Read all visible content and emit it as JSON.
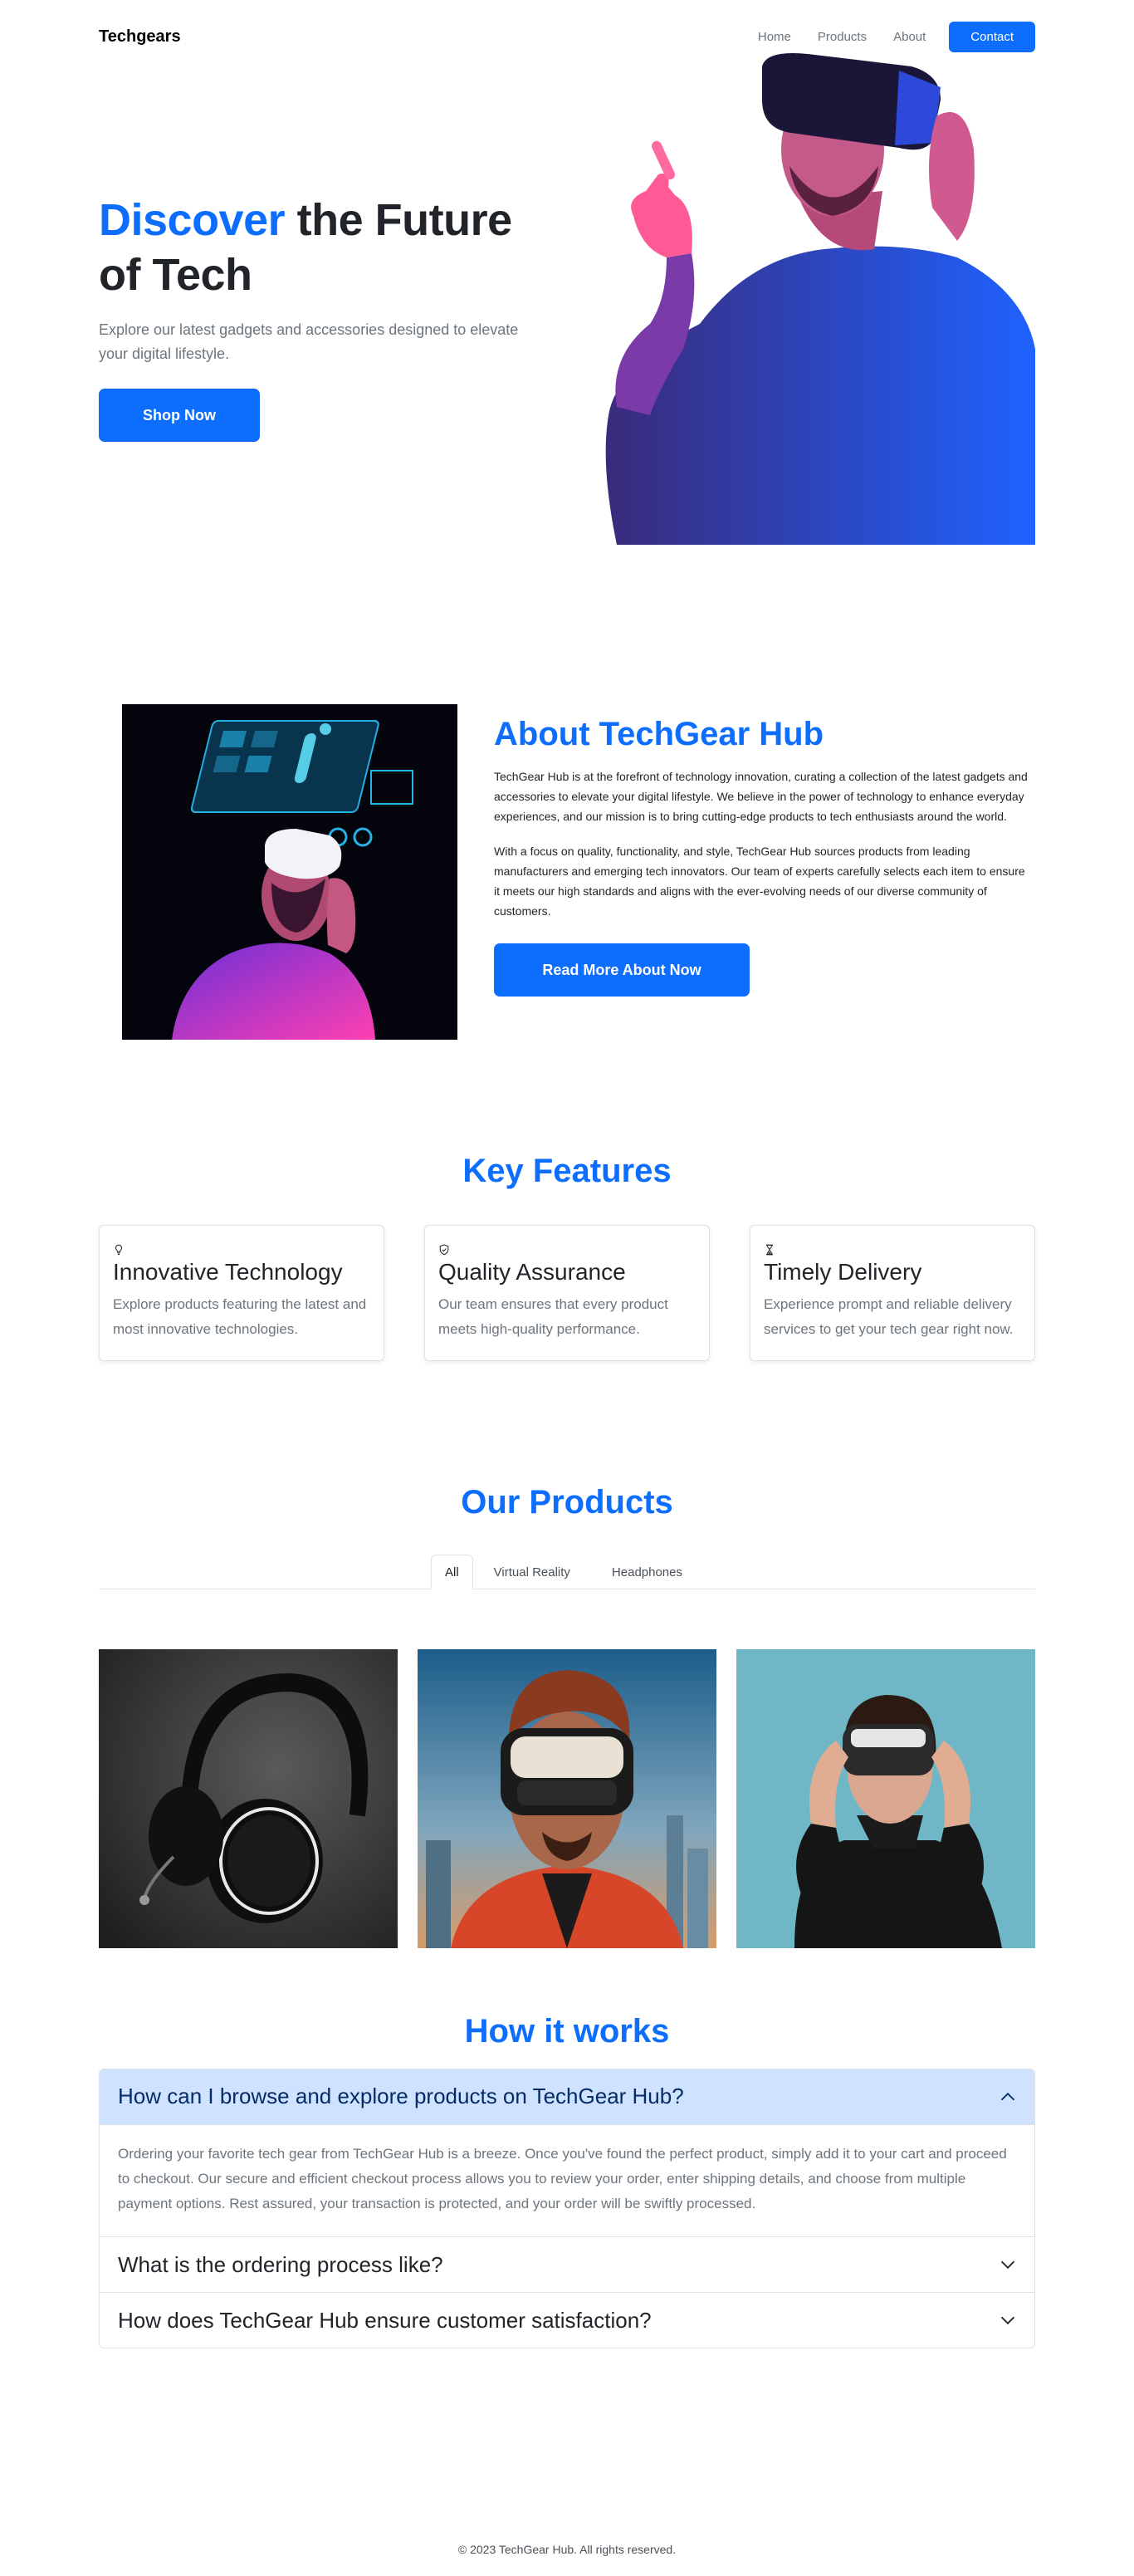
{
  "nav": {
    "brand": "Techgears",
    "links": [
      "Home",
      "Products",
      "About"
    ],
    "contact": "Contact"
  },
  "hero": {
    "title_accent": "Discover",
    "title_rest": " the Future of Tech",
    "subtitle": "Explore our latest gadgets and accessories designed to elevate your digital lifestyle.",
    "button": "Shop Now"
  },
  "about": {
    "title": "About TechGear Hub",
    "p1": "TechGear Hub is at the forefront of technology innovation, curating a collection of the latest gadgets and accessories to elevate your digital lifestyle. We believe in the power of technology to enhance everyday experiences, and our mission is to bring cutting-edge products to tech enthusiasts around the world.",
    "p2": "With a focus on quality, functionality, and style, TechGear Hub sources products from leading manufacturers and emerging tech innovators. Our team of experts carefully selects each item to ensure it meets our high standards and aligns with the ever-evolving needs of our diverse community of customers.",
    "button": "Read More About Now"
  },
  "features": {
    "title": "Key Features",
    "items": [
      {
        "icon": "lightbulb-icon",
        "title": "Innovative Technology",
        "text": "Explore products featuring the latest and most innovative technologies."
      },
      {
        "icon": "shield-check-icon",
        "title": "Quality Assurance",
        "text": "Our team ensures that every product meets high-quality performance."
      },
      {
        "icon": "hourglass-icon",
        "title": "Timely Delivery",
        "text": "Experience prompt and reliable delivery services to get your tech gear right now."
      }
    ]
  },
  "products": {
    "title": "Our Products",
    "tabs": [
      "All",
      "Virtual Reality",
      "Headphones"
    ],
    "active_tab": "All",
    "items": [
      "headphones-product-image",
      "vr-headset-man-product-image",
      "vr-headset-woman-product-image"
    ]
  },
  "faq": {
    "title": "How it works",
    "items": [
      {
        "q": "How can I browse and explore products on TechGear Hub?",
        "a": "Ordering your favorite tech gear from TechGear Hub is a breeze. Once you've found the perfect product, simply add it to your cart and proceed to checkout. Our secure and efficient checkout process allows you to review your order, enter shipping details, and choose from multiple payment options. Rest assured, your transaction is protected, and your order will be swiftly processed.",
        "open": true
      },
      {
        "q": "What is the ordering process like?",
        "open": false
      },
      {
        "q": "How does TechGear Hub ensure customer satisfaction?",
        "open": false
      }
    ]
  },
  "footer": {
    "text": "© 2023 TechGear Hub. All rights reserved."
  },
  "colors": {
    "primary": "#0d6efd",
    "accordion_open_bg": "#cfe2ff",
    "muted_text": "#6c757d"
  }
}
